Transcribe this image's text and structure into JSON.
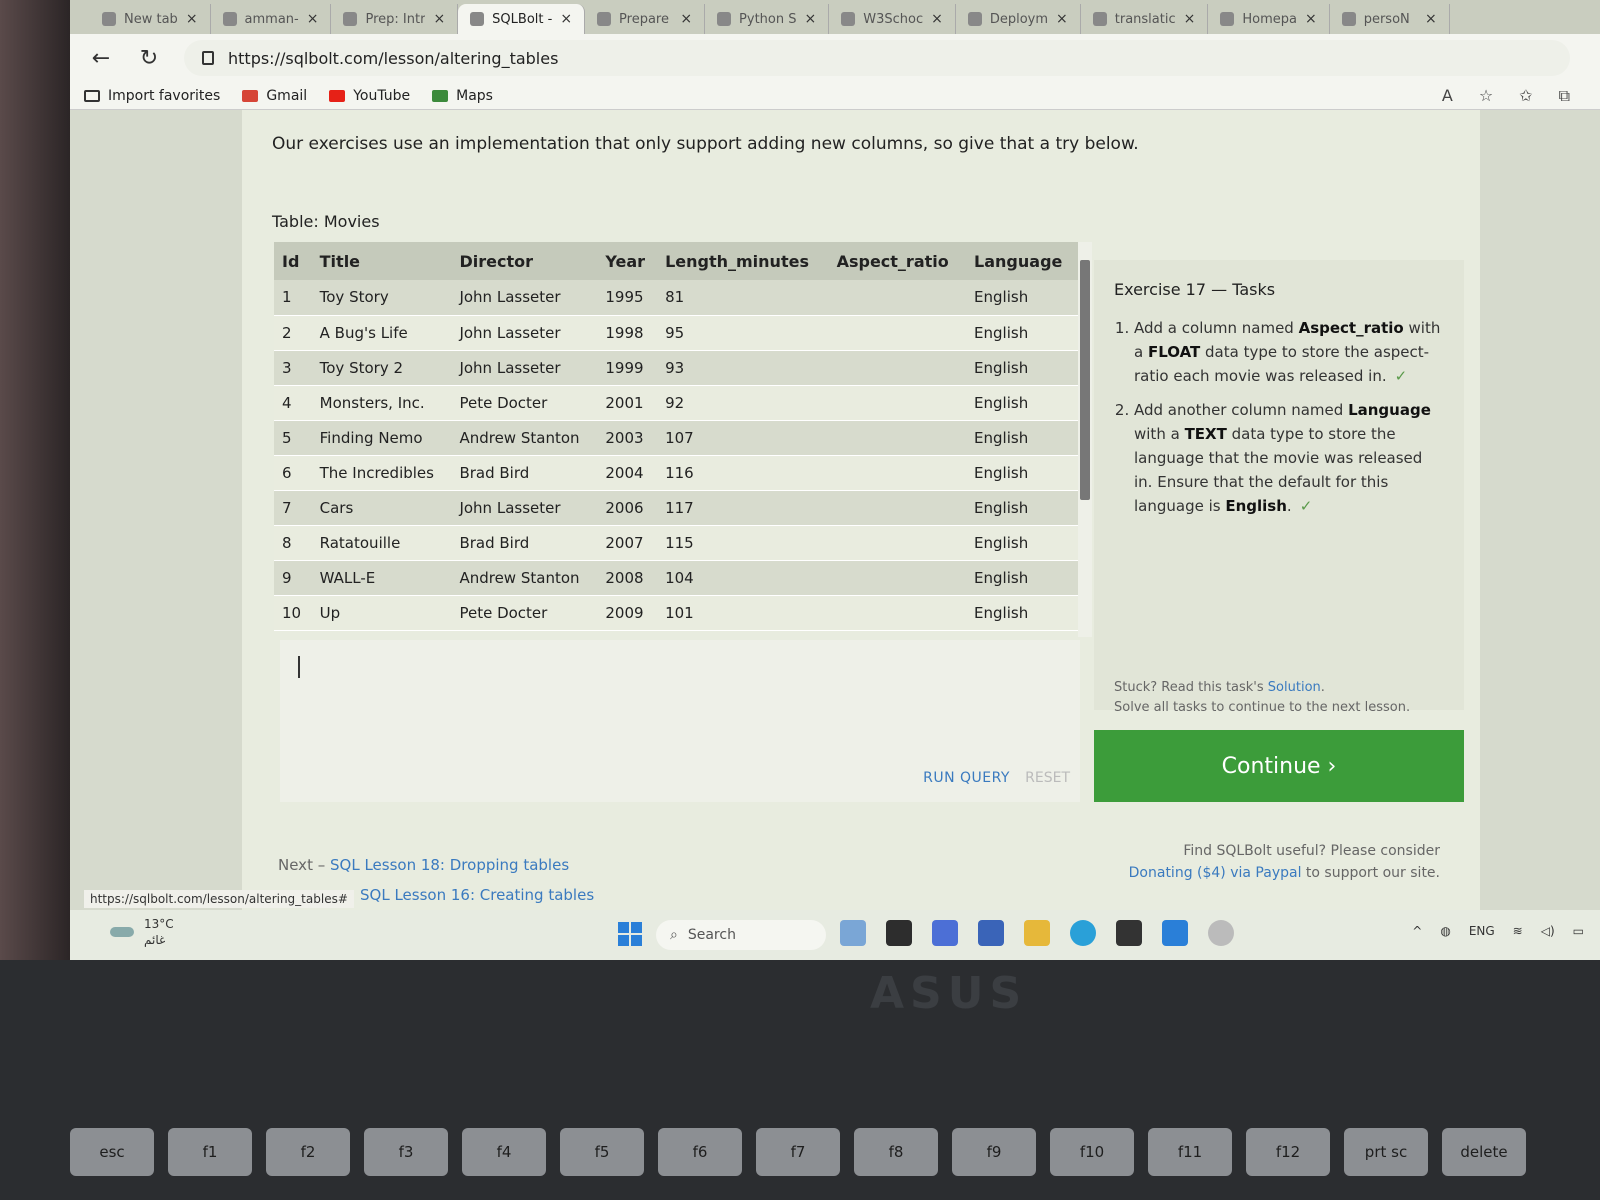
{
  "browser": {
    "tabs": [
      {
        "label": "New tab"
      },
      {
        "label": "amman-"
      },
      {
        "label": "Prep: Intr"
      },
      {
        "label": "SQLBolt -",
        "active": true
      },
      {
        "label": "Prepare"
      },
      {
        "label": "Python S"
      },
      {
        "label": "W3Schoc"
      },
      {
        "label": "Deploym"
      },
      {
        "label": "translatic"
      },
      {
        "label": "Homepa"
      },
      {
        "label": "persoN"
      }
    ],
    "url": "https://sqlbolt.com/lesson/altering_tables",
    "bookmarks": [
      {
        "label": "Import favorites"
      },
      {
        "label": "Gmail"
      },
      {
        "label": "YouTube"
      },
      {
        "label": "Maps"
      }
    ]
  },
  "page": {
    "intro": "Our exercises use an implementation that only support adding new columns, so give that a try below.",
    "table_caption": "Table: Movies",
    "columns": [
      "Id",
      "Title",
      "Director",
      "Year",
      "Length_minutes",
      "Aspect_ratio",
      "Language"
    ],
    "rows": [
      [
        "1",
        "Toy Story",
        "John Lasseter",
        "1995",
        "81",
        "",
        "English"
      ],
      [
        "2",
        "A Bug's Life",
        "John Lasseter",
        "1998",
        "95",
        "",
        "English"
      ],
      [
        "3",
        "Toy Story 2",
        "John Lasseter",
        "1999",
        "93",
        "",
        "English"
      ],
      [
        "4",
        "Monsters, Inc.",
        "Pete Docter",
        "2001",
        "92",
        "",
        "English"
      ],
      [
        "5",
        "Finding Nemo",
        "Andrew Stanton",
        "2003",
        "107",
        "",
        "English"
      ],
      [
        "6",
        "The Incredibles",
        "Brad Bird",
        "2004",
        "116",
        "",
        "English"
      ],
      [
        "7",
        "Cars",
        "John Lasseter",
        "2006",
        "117",
        "",
        "English"
      ],
      [
        "8",
        "Ratatouille",
        "Brad Bird",
        "2007",
        "115",
        "",
        "English"
      ],
      [
        "9",
        "WALL-E",
        "Andrew Stanton",
        "2008",
        "104",
        "",
        "English"
      ],
      [
        "10",
        "Up",
        "Pete Docter",
        "2009",
        "101",
        "",
        "English"
      ]
    ],
    "run_query": "RUN QUERY",
    "reset": "RESET",
    "tasks_title": "Exercise 17 — Tasks",
    "task1_pre": "Add a column named ",
    "task1_bold1": "Aspect_ratio",
    "task1_mid": " with a ",
    "task1_bold2": "FLOAT",
    "task1_post": " data type to store the aspect-ratio each movie was released in.",
    "task2_pre": "Add another column named ",
    "task2_bold1": "Language",
    "task2_mid": " with a ",
    "task2_bold2": "TEXT",
    "task2_post": " data type to store the language that the movie was released in. Ensure that the default for this language is ",
    "task2_bold3": "English",
    "task2_end": ".",
    "check": "✓",
    "stuck_pre": "Stuck? Read this task's ",
    "stuck_link": "Solution",
    "stuck_post": ".",
    "solve_all": "Solve all tasks to continue to the next lesson.",
    "continue": "Continue ›",
    "donate_line1": "Find SQLBolt useful? Please consider",
    "donate_link": "Donating ($4) via Paypal",
    "donate_post": " to support our site.",
    "next_pre": "Next – ",
    "next_link": "SQL Lesson 18: Dropping tables",
    "status_url": "https://sqlbolt.com/lesson/altering_tables#",
    "prev_link": "SQL Lesson 16: Creating tables"
  },
  "taskbar": {
    "temperature": "13°C",
    "weather_label": "غائم",
    "search": "Search",
    "lang": "ENG"
  },
  "keyboard": {
    "brand": "ASUS",
    "keys": [
      "esc",
      "f1",
      "f2",
      "f3",
      "f4",
      "f5",
      "f6",
      "f7",
      "f8",
      "f9",
      "f10",
      "f11",
      "f12",
      "prt sc",
      "delete"
    ]
  }
}
